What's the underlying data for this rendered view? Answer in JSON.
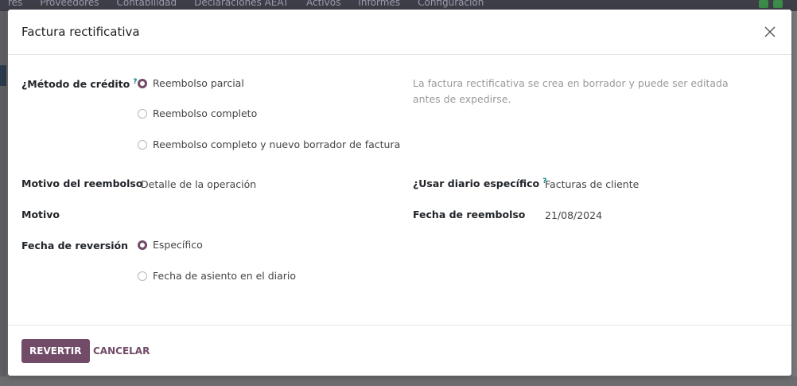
{
  "background": {
    "menu": [
      "res",
      "Proveedores",
      "Contabilidad",
      "Declaraciones AEAT",
      "Activos",
      "Informes",
      "Configuración"
    ]
  },
  "dialog": {
    "title": "Factura rectificativa",
    "credit_method": {
      "label": "¿Método de crédito",
      "help": "?",
      "options": [
        "Reembolso parcial",
        "Reembolso completo",
        "Reembolso completo y nuevo borrador de factura"
      ],
      "selected_index": 0,
      "hint": "La factura rectificativa se crea en borrador y puede ser editada antes de expedirse."
    },
    "reason_refund": {
      "label": "Motivo del reembolso",
      "value": "Detalle de la operación"
    },
    "reason": {
      "label": "Motivo",
      "value": ""
    },
    "specific_journal": {
      "label": "¿Usar diario específico",
      "help": "?",
      "value": "Facturas de cliente"
    },
    "refund_date": {
      "label": "Fecha de reembolso",
      "value": "21/08/2024"
    },
    "reversal_date": {
      "label": "Fecha de reversión",
      "options": [
        "Específico",
        "Fecha de asiento en el diario"
      ],
      "selected_index": 0
    },
    "buttons": {
      "confirm": "REVERTIR",
      "cancel": "CANCELAR"
    }
  },
  "colors": {
    "accent": "#714b67",
    "help": "#017e84"
  }
}
